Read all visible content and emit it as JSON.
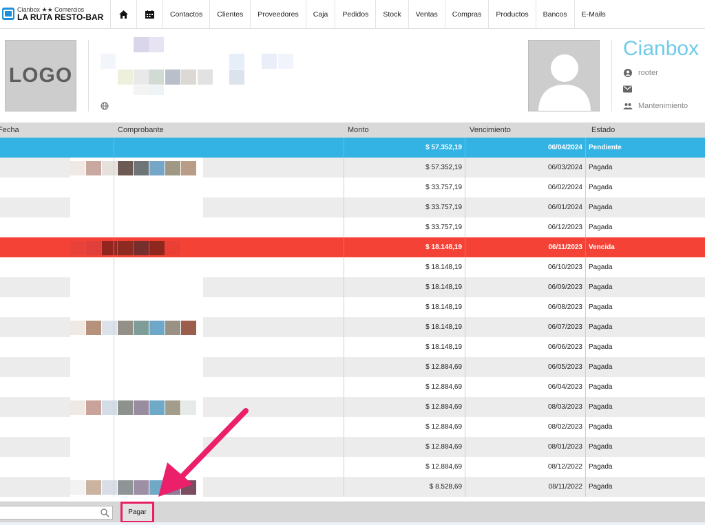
{
  "brand": {
    "subtitle": "Cianbox ★★ Comercios",
    "name": "LA RUTA RESTO-BAR"
  },
  "nav": {
    "items": [
      "Contactos",
      "Clientes",
      "Proveedores",
      "Caja",
      "Pedidos",
      "Stock",
      "Ventas",
      "Compras",
      "Productos",
      "Bancos",
      "E-Mails"
    ],
    "icons": [
      "home-icon",
      "calendar-icon"
    ]
  },
  "header": {
    "logo_text": "LOGO",
    "company": "Cianbox",
    "user": "rooter",
    "email": "",
    "group": "Mantenimiento"
  },
  "table": {
    "columns": [
      "Fecha",
      "Comprobante",
      "Monto",
      "Vencimiento",
      "Estado"
    ],
    "rows": [
      {
        "monto": "$ 57.352,19",
        "vencimiento": "06/04/2024",
        "estado": "Pendiente",
        "state": "selected"
      },
      {
        "monto": "$ 57.352,19",
        "vencimiento": "06/03/2024",
        "estado": "Pagada",
        "state": "even"
      },
      {
        "monto": "$ 33.757,19",
        "vencimiento": "06/02/2024",
        "estado": "Pagada",
        "state": "odd"
      },
      {
        "monto": "$ 33.757,19",
        "vencimiento": "06/01/2024",
        "estado": "Pagada",
        "state": "even"
      },
      {
        "monto": "$ 33.757,19",
        "vencimiento": "06/12/2023",
        "estado": "Pagada",
        "state": "odd"
      },
      {
        "monto": "$ 18.148,19",
        "vencimiento": "06/11/2023",
        "estado": "Vencida",
        "state": "overdue"
      },
      {
        "monto": "$ 18.148,19",
        "vencimiento": "06/10/2023",
        "estado": "Pagada",
        "state": "odd"
      },
      {
        "monto": "$ 18.148,19",
        "vencimiento": "06/09/2023",
        "estado": "Pagada",
        "state": "even"
      },
      {
        "monto": "$ 18.148,19",
        "vencimiento": "06/08/2023",
        "estado": "Pagada",
        "state": "odd"
      },
      {
        "monto": "$ 18.148,19",
        "vencimiento": "06/07/2023",
        "estado": "Pagada",
        "state": "even"
      },
      {
        "monto": "$ 18.148,19",
        "vencimiento": "06/06/2023",
        "estado": "Pagada",
        "state": "odd"
      },
      {
        "monto": "$ 12.884,69",
        "vencimiento": "06/05/2023",
        "estado": "Pagada",
        "state": "even"
      },
      {
        "monto": "$ 12.884,69",
        "vencimiento": "06/04/2023",
        "estado": "Pagada",
        "state": "odd"
      },
      {
        "monto": "$ 12.884,69",
        "vencimiento": "08/03/2023",
        "estado": "Pagada",
        "state": "even"
      },
      {
        "monto": "$ 12.884,69",
        "vencimiento": "08/02/2023",
        "estado": "Pagada",
        "state": "odd"
      },
      {
        "monto": "$ 12.884,69",
        "vencimiento": "08/01/2023",
        "estado": "Pagada",
        "state": "even"
      },
      {
        "monto": "$ 12.884,69",
        "vencimiento": "08/12/2022",
        "estado": "Pagada",
        "state": "odd"
      },
      {
        "monto": "$ 8.528,69",
        "vencimiento": "08/11/2022",
        "estado": "Pagada",
        "state": "even"
      }
    ]
  },
  "footer": {
    "search_placeholder": "",
    "pay_label": "Pagar"
  },
  "colors": {
    "selected": "#33b3e3",
    "overdue": "#f44336",
    "accent": "#6ecbe9",
    "annotation": "#e91e63"
  }
}
